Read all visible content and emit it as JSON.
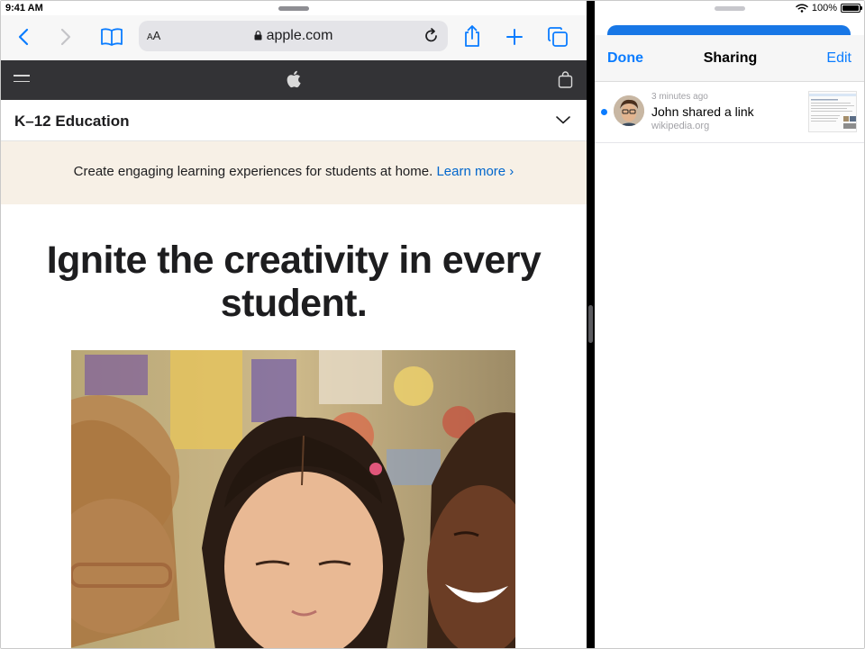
{
  "status_bar": {
    "time": "9:41 AM",
    "battery": "100%"
  },
  "safari": {
    "address": {
      "text_size_label": "AA",
      "domain": "apple.com"
    },
    "icons": {
      "back": "chevron-left-icon",
      "forward": "chevron-right-icon",
      "bookmarks": "book-icon",
      "lock": "lock-icon",
      "reload": "reload-icon",
      "share": "share-icon",
      "new_tab": "plus-icon",
      "tabs": "tabs-icon"
    }
  },
  "apple_site": {
    "section_title": "K–12 Education",
    "banner": {
      "text": "Create engaging learning experiences for students at home.",
      "link": "Learn more ›"
    },
    "hero": {
      "title": "Ignite the creativity in every student."
    }
  },
  "sharing": {
    "done_label": "Done",
    "title": "Sharing",
    "edit_label": "Edit",
    "items": [
      {
        "time": "3 minutes ago",
        "title": "John shared a link",
        "domain": "wikipedia.org"
      }
    ]
  },
  "colors": {
    "accent": "#0a7cff",
    "link": "#0066cc",
    "nav_bg": "#333336",
    "banner_bg": "#f7f0e6",
    "sheet_blue": "#1877e6"
  }
}
